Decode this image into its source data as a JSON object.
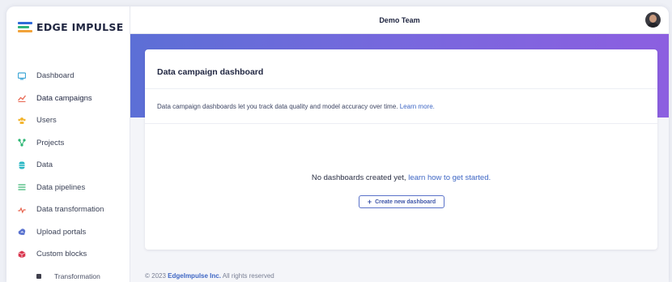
{
  "app": {
    "brand": "EDGE IMPULSE",
    "team_name": "Demo Team"
  },
  "colors": {
    "accent": "#3e66c4",
    "hero_gradient_start": "#5c6fd6",
    "hero_gradient_end": "#8c5fe0"
  },
  "sidebar": {
    "items": [
      {
        "label": "Dashboard",
        "icon": "monitor-icon"
      },
      {
        "label": "Data campaigns",
        "icon": "trend-chart-icon"
      },
      {
        "label": "Users",
        "icon": "users-icon"
      },
      {
        "label": "Projects",
        "icon": "projects-icon"
      },
      {
        "label": "Data",
        "icon": "database-icon"
      },
      {
        "label": "Data pipelines",
        "icon": "pipeline-icon"
      },
      {
        "label": "Data transformation",
        "icon": "pulse-icon"
      },
      {
        "label": "Upload portals",
        "icon": "cloud-upload-icon"
      },
      {
        "label": "Custom blocks",
        "icon": "cube-icon"
      },
      {
        "label": "Transformation",
        "icon": "square-icon"
      }
    ]
  },
  "main": {
    "card_title": "Data campaign dashboard",
    "description": "Data campaign dashboards let you track data quality and model accuracy over time.",
    "learn_more": "Learn more.",
    "empty_text": "No dashboards created yet,",
    "empty_link": "learn how to get started.",
    "create_button": "Create new dashboard"
  },
  "footer": {
    "prefix": "© 2023",
    "company": "EdgeImpulse Inc.",
    "suffix": "All rights reserved"
  }
}
